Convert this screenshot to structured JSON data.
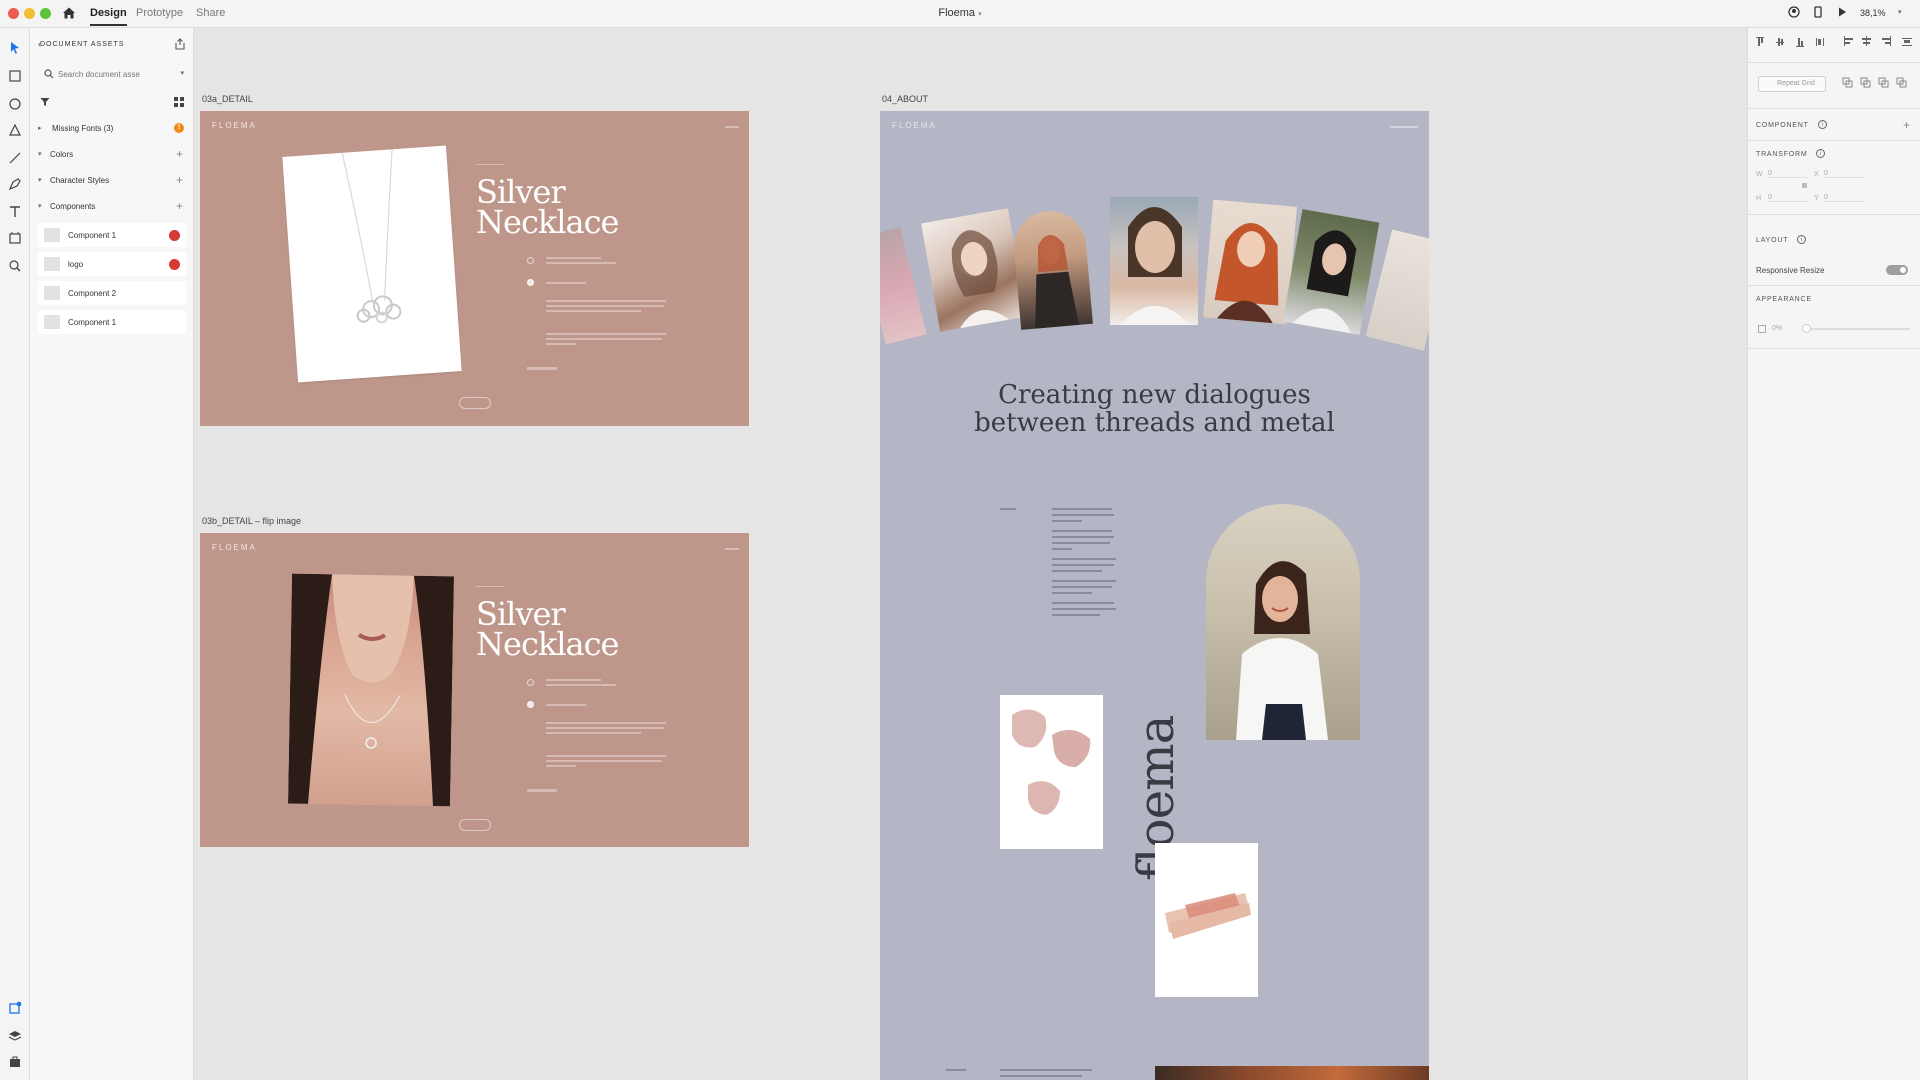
{
  "titlebar": {
    "tabs": [
      "Design",
      "Prototype",
      "Share"
    ],
    "doc_title": "Floema",
    "zoom": "38,1%"
  },
  "assets": {
    "header": "DOCUMENT ASSETS",
    "search_placeholder": "Search document asse",
    "missing_fonts": "Missing Fonts (3)",
    "colors": "Colors",
    "character_styles": "Character Styles",
    "components_header": "Components",
    "components": [
      {
        "name": "Component 1",
        "badge": true
      },
      {
        "name": "logo",
        "badge": true
      },
      {
        "name": "Component 2",
        "badge": false
      },
      {
        "name": "Component 1",
        "badge": false
      }
    ]
  },
  "props": {
    "repeat_grid": "Repeat Grid",
    "component": "COMPONENT",
    "transform": "TRANSFORM",
    "w_label": "W",
    "w_value": "0",
    "x_label": "X",
    "x_value": "0",
    "h_label": "H",
    "h_value": "0",
    "y_label": "Y",
    "y_value": "0",
    "layout": "LAYOUT",
    "responsive_resize": "Responsive Resize",
    "appearance": "APPEARANCE",
    "opacity": "0%"
  },
  "canvas": {
    "artboard_a": {
      "label": "03a_DETAIL",
      "brand": "FLOEMA",
      "title_1": "Silver",
      "title_2": "Necklace"
    },
    "artboard_b": {
      "label": "03b_DETAIL – flip image",
      "brand": "FLOEMA",
      "title_1": "Silver",
      "title_2": "Necklace"
    },
    "artboard_c": {
      "label": "04_ABOUT",
      "brand": "FLOEMA",
      "headline_1": "Creating new dialogues",
      "headline_2": "between threads and metal",
      "vertical_brand": "floema"
    }
  }
}
